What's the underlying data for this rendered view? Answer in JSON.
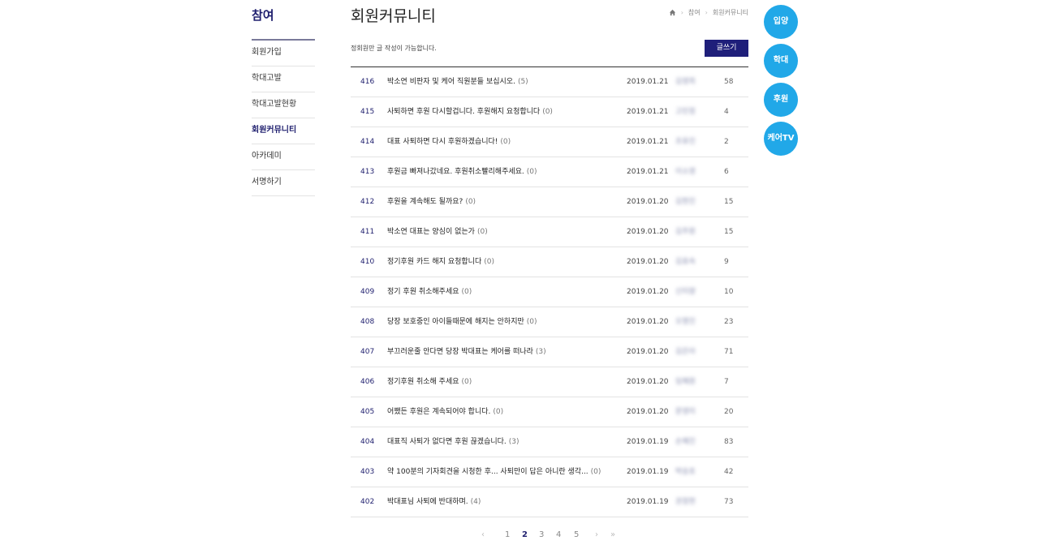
{
  "sidebar": {
    "title": "참여",
    "items": [
      {
        "label": "회원가입"
      },
      {
        "label": "학대고발"
      },
      {
        "label": "학대고발현황"
      },
      {
        "label": "회원커뮤니티"
      },
      {
        "label": "아카데미"
      },
      {
        "label": "서명하기"
      }
    ],
    "active_index": 3
  },
  "header": {
    "title": "회원커뮤니티",
    "breadcrumb": [
      "참여",
      "회원커뮤니티"
    ]
  },
  "notice": "정회원만 글 작성이 가능합니다.",
  "write_label": "글쓰기",
  "posts": [
    {
      "num": "416",
      "title": "박소연 비판자 및 케어 직원분들 보십시오.",
      "comments": "(5)",
      "date": "2019.01.21",
      "author": "김영희",
      "views": "58"
    },
    {
      "num": "415",
      "title": "사퇴하면 후원 다시할겁니다. 후원해지 요청합니다",
      "comments": "(0)",
      "date": "2019.01.21",
      "author": "고민정",
      "views": "4"
    },
    {
      "num": "414",
      "title": "대표 사퇴하면 다시 후원하겠습니다!",
      "comments": "(0)",
      "date": "2019.01.21",
      "author": "조유진",
      "views": "2"
    },
    {
      "num": "413",
      "title": "후원금 빠져나갔네요. 후원취소빨리해주세요.",
      "comments": "(0)",
      "date": "2019.01.21",
      "author": "이소영",
      "views": "6"
    },
    {
      "num": "412",
      "title": "후원을 계속해도 될까요?",
      "comments": "(0)",
      "date": "2019.01.20",
      "author": "김현진",
      "views": "15"
    },
    {
      "num": "411",
      "title": "박소연 대표는 양심이 없는가",
      "comments": "(0)",
      "date": "2019.01.20",
      "author": "김주원",
      "views": "15"
    },
    {
      "num": "410",
      "title": "정기후원 카드 해지 요청합니다",
      "comments": "(0)",
      "date": "2019.01.20",
      "author": "김효숙",
      "views": "9"
    },
    {
      "num": "409",
      "title": "정기 후원 취소해주세요",
      "comments": "(0)",
      "date": "2019.01.20",
      "author": "신미향",
      "views": "10"
    },
    {
      "num": "408",
      "title": "당장 보호중인 아이들때문에 해지는 안하지만",
      "comments": "(0)",
      "date": "2019.01.20",
      "author": "오명진",
      "views": "23"
    },
    {
      "num": "407",
      "title": "부끄러운줄 안다면 당장 박대표는 케어를 떠나라",
      "comments": "(3)",
      "date": "2019.01.20",
      "author": "김은아",
      "views": "71"
    },
    {
      "num": "406",
      "title": "정기후원 취소해 주세요",
      "comments": "(0)",
      "date": "2019.01.20",
      "author": "임혜원",
      "views": "7"
    },
    {
      "num": "405",
      "title": "어쨌든 후원은 계속되어야 합니다.",
      "comments": "(0)",
      "date": "2019.01.20",
      "author": "문영미",
      "views": "20"
    },
    {
      "num": "404",
      "title": "대표직 사퇴가 없다면 후원 끊겠습니다.",
      "comments": "(3)",
      "date": "2019.01.19",
      "author": "손혜진",
      "views": "83"
    },
    {
      "num": "403",
      "title": "약 100분의 기자회견을 시청한 후... 사퇴만이 답은 아니란 생각...",
      "comments": "(0)",
      "date": "2019.01.19",
      "author": "박승호",
      "views": "42"
    },
    {
      "num": "402",
      "title": "박대표님 사퇴에 반대하며.",
      "comments": "(4)",
      "date": "2019.01.19",
      "author": "권정현",
      "views": "73"
    }
  ],
  "pagination": {
    "prev": "‹",
    "pages": [
      "1",
      "2",
      "3",
      "4",
      "5"
    ],
    "current": "2",
    "next": "›",
    "last": "»"
  },
  "floating_buttons": [
    "입양",
    "학대",
    "후원",
    "케어TV"
  ],
  "colors": {
    "accent": "#1f1f7a",
    "fab": "#21a8e8"
  }
}
